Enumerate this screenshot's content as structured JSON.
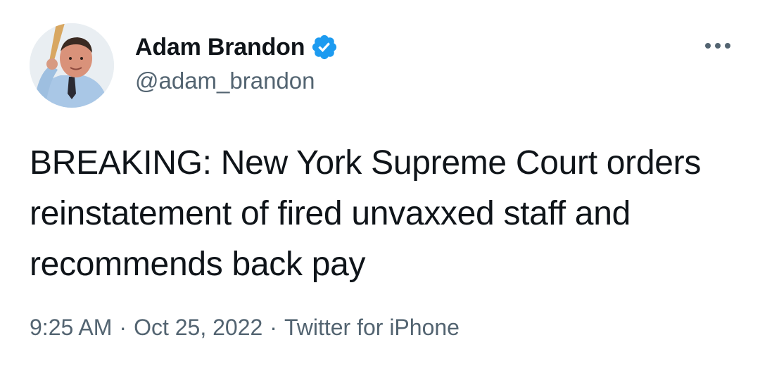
{
  "author": {
    "display_name": "Adam Brandon",
    "handle": "@adam_brandon",
    "verified": true
  },
  "tweet": {
    "text": "BREAKING: New York Supreme Court orders reinstatement of fired unvaxxed staff and recommends back pay"
  },
  "meta": {
    "time": "9:25 AM",
    "separator": "·",
    "date": "Oct 25, 2022",
    "source": "Twitter for iPhone"
  },
  "icons": {
    "verified": "verified-badge-icon",
    "more": "more-horizontal-icon"
  },
  "colors": {
    "verified_blue": "#1d9bf0",
    "secondary_text": "#536471",
    "primary_text": "#0f1419"
  }
}
